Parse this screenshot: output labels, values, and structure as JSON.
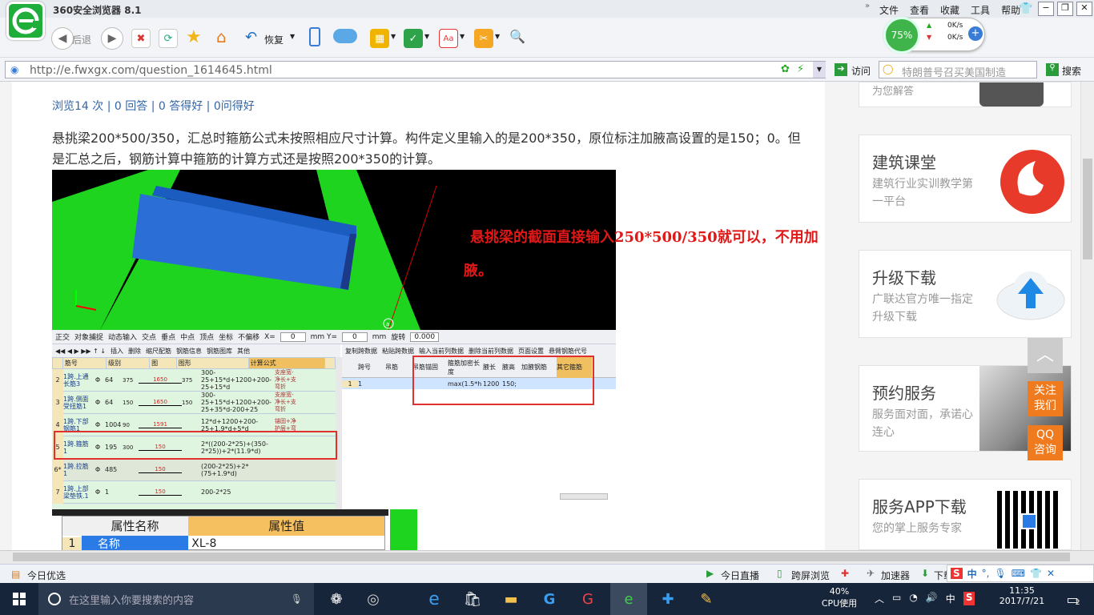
{
  "browser": {
    "title": "360安全浏览器 8.1",
    "menu": [
      "文件",
      "查看",
      "收藏",
      "工具",
      "帮助"
    ],
    "back_label": "后退",
    "restore_label": "恢复",
    "speed_percent": "75%",
    "speed_up": "0K/s",
    "speed_down": "0K/s",
    "url": "http://e.fwxgx.com/question_1614645.html",
    "visit_label": "访问",
    "search_placeholder": "特朗普号召买美国制造",
    "search_btn": "搜索"
  },
  "question": {
    "stats": "浏览14 次 | 0 回答 | 0 答得好 | 0问得好",
    "body": "悬挑梁200*500/350，汇总时箍筋公式未按照相应尺寸计算。构件定义里输入的是200*350，原位标注加腋高设置的是150；0。但是汇总之后，钢筋计算中箍筋的计算方式还是按照200*350的计算。",
    "answer_line1": "悬挑梁的截面直接输入250*500/350就可以，不用加",
    "answer_line2": "腋。"
  },
  "cad": {
    "axis_label": "a",
    "snap_toolbar": [
      "正交",
      "对象捕捉",
      "动态输入",
      "交点",
      "垂点",
      "中点",
      "顶点",
      "坐标",
      "不偏移"
    ],
    "x_label": "X=",
    "x_val": "0",
    "y_label": "mm Y=",
    "y_val": "0",
    "mm_label": "mm",
    "rotate_label": "旋转",
    "rotate_val": "0.000",
    "left_toolbar": [
      "插入",
      "删除",
      "缩尺配筋",
      "钢筋信息",
      "钢筋图库",
      "其他"
    ],
    "right_toolbar": [
      "复制跨数据",
      "粘贴跨数据",
      "输入当前列数据",
      "删除当前列数据",
      "页面设置",
      "悬臂钢筋代号"
    ],
    "left_headers": [
      "筋号",
      "级别",
      "图",
      "图形",
      "计算公式",
      ""
    ],
    "rows": [
      {
        "n": "2",
        "name": "1跨.上通长筋3",
        "grade": "Φ",
        "dia": "64",
        "left": "375",
        "mid": "1650",
        "right": "375",
        "formula": "300-25+15*d+1200+200-25+15*d",
        "note": "支座宽-净长+支弯折"
      },
      {
        "n": "3",
        "name": "1跨.侧面受扭筋1",
        "grade": "Φ",
        "dia": "64",
        "left": "150",
        "mid": "1650",
        "right": "150",
        "formula": "300-25+15*d+1200+200-25+35*d-200+25",
        "note": "支座宽-净长+支弯折"
      },
      {
        "n": "4",
        "name": "1跨.下部钢筋1",
        "grade": "Φ",
        "dia": "1004",
        "left": "90",
        "mid": "1591",
        "right": "",
        "formula": "12*d+1200+200-25+1.9*d+5*d",
        "note": "锚固+净护层+弯"
      },
      {
        "n": "5",
        "name": "1跨.箍筋1",
        "grade": "Φ",
        "dia": "195",
        "left": "300",
        "mid": "150",
        "right": "",
        "formula": "2*((200-2*25)+(350-2*25))+2*(11.9*d)",
        "note": ""
      },
      {
        "n": "6*",
        "name": "1跨.拉筋1",
        "grade": "Φ",
        "dia": "485",
        "left": "",
        "mid": "150",
        "right": "",
        "formula": "(200-2*25)+2*(75+1.9*d)",
        "note": ""
      },
      {
        "n": "7",
        "name": "1跨.上部梁垫铁.1",
        "grade": "Φ",
        "dia": "1",
        "left": "",
        "mid": "150",
        "right": "",
        "formula": "200-2*25",
        "note": ""
      }
    ],
    "right_headers": [
      "跨号",
      "吊筋",
      "吊筋锚固",
      "箍筋加密长度",
      "腋长",
      "腋高",
      "加腋钢筋",
      "其它箍筋"
    ],
    "right_row": {
      "row": "1",
      "span": "1",
      "stirrup": "max(1.5*h",
      "len": "1200",
      "height": "150;"
    },
    "prop_header_name": "属性名称",
    "prop_header_val": "属性值",
    "prop_row": {
      "n": "1",
      "name": "名称",
      "val": "XL-8"
    }
  },
  "sidebar": {
    "top_card": "为您解答",
    "cards": [
      {
        "title": "建筑课堂",
        "desc": "建筑行业实训教学第一平台",
        "icon": "fire-logo"
      },
      {
        "title": "升级下载",
        "desc": "广联达官方唯一指定升级下载",
        "icon": "cloud-upload-icon"
      },
      {
        "title": "预约服务",
        "desc": "服务面对面，承诺心连心",
        "icon": "handshake-photo"
      },
      {
        "title": "服务APP下载",
        "desc": "您的掌上服务专家",
        "icon": "qr-code"
      }
    ],
    "follow": "关注我们",
    "qq": "QQ咨询"
  },
  "status": {
    "left": "今日优选",
    "items": [
      "今日直播",
      "跨屏浏览",
      "加速器",
      "下载"
    ]
  },
  "taskbar": {
    "search_placeholder": "在这里输入你要搜索的内容",
    "cpu": "40%",
    "cpu_label": "CPU使用",
    "time": "11:35",
    "date": "2017/7/21",
    "ime": "中",
    "notif": "2"
  }
}
